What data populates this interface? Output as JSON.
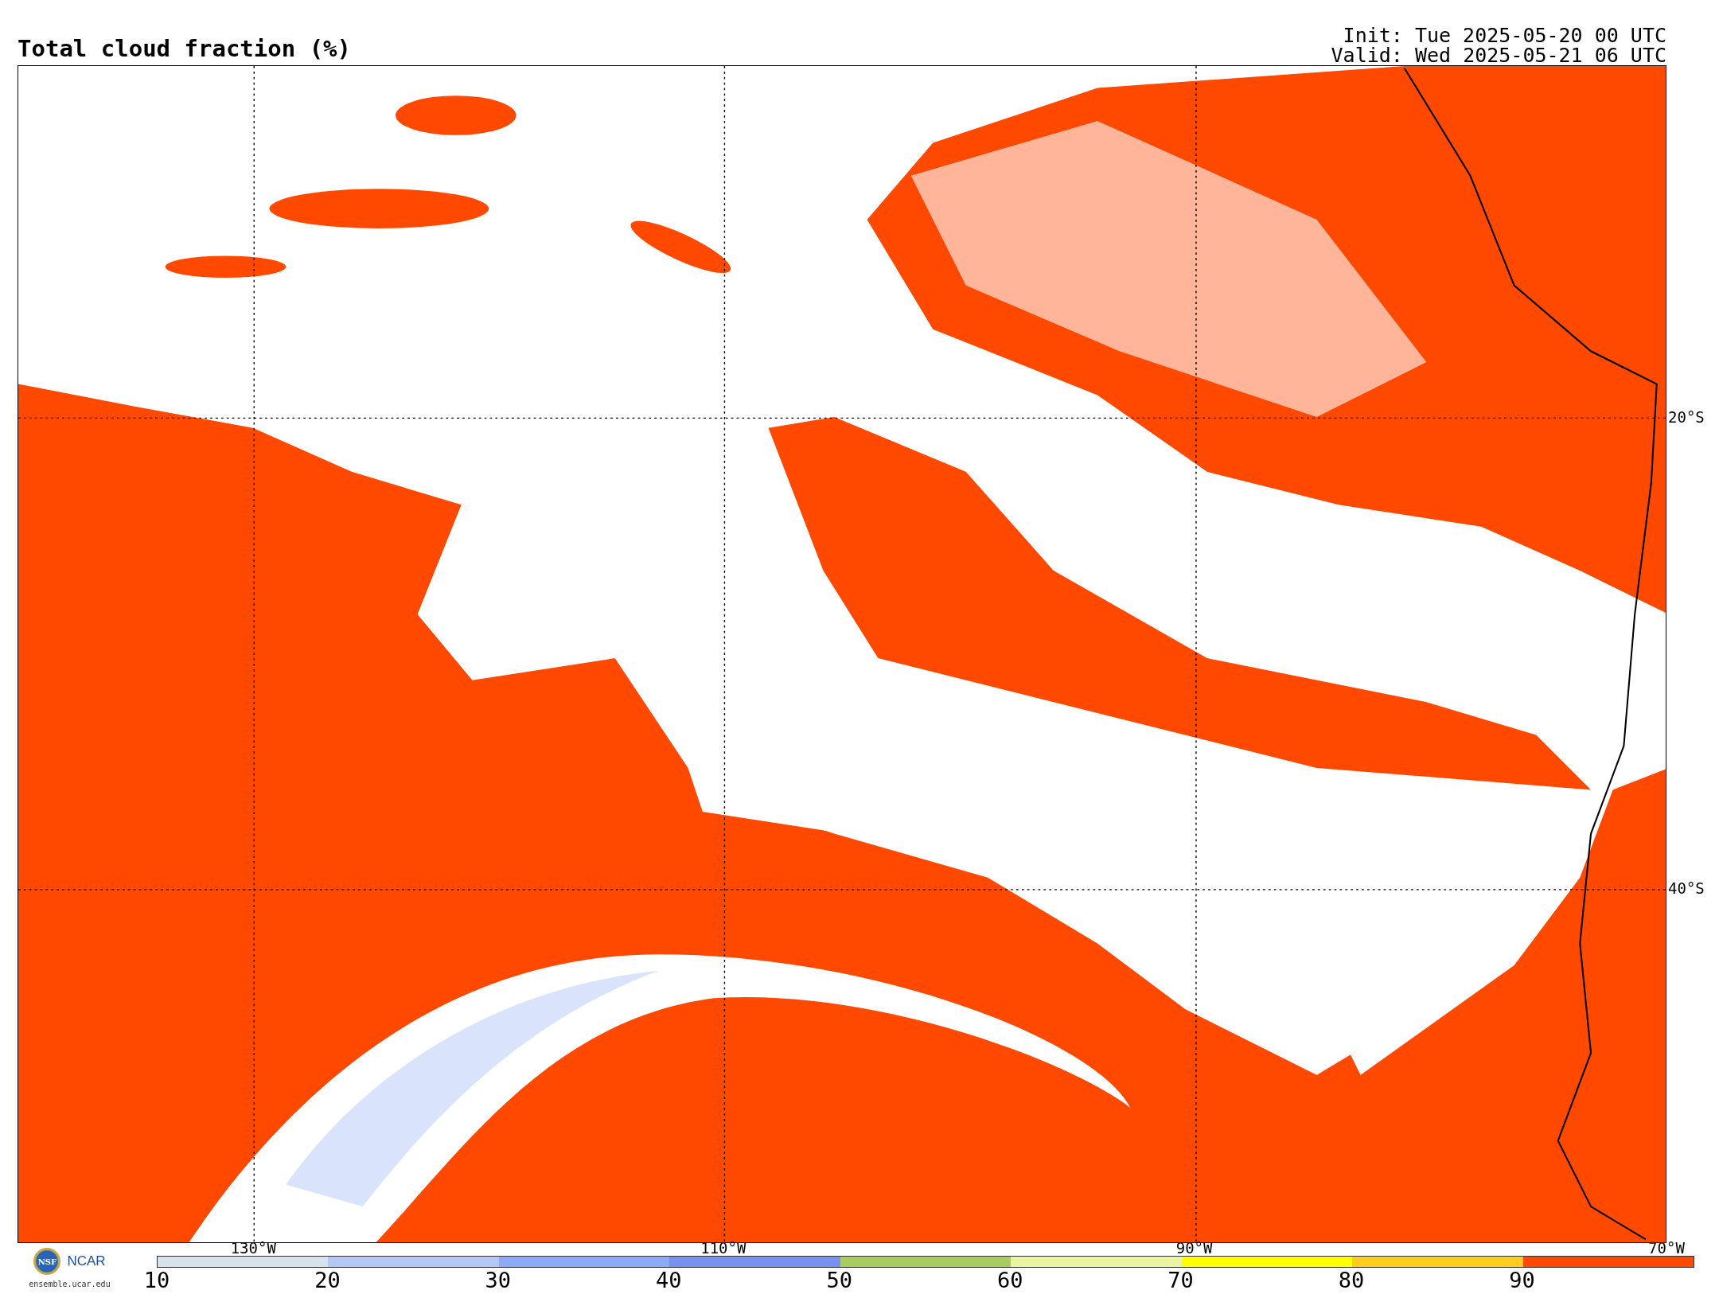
{
  "title": "Total cloud fraction (%)",
  "init": "Init: Tue 2025-05-20 00 UTC",
  "valid": "Valid: Wed 2025-05-21 06 UTC",
  "lat_labels": [
    "20°S",
    "40°S"
  ],
  "lon_labels": [
    "130°W",
    "110°W",
    "90°W",
    "70°W"
  ],
  "colorbar": [
    {
      "label": "10",
      "color": "#d6e2ec"
    },
    {
      "label": "20",
      "color": "#b4c8f8"
    },
    {
      "label": "30",
      "color": "#8caaf8"
    },
    {
      "label": "40",
      "color": "#7890f0"
    },
    {
      "label": "50",
      "color": "#a8cc60"
    },
    {
      "label": "60",
      "color": "#e8f4a0"
    },
    {
      "label": "70",
      "color": "#ffff00"
    },
    {
      "label": "80",
      "color": "#ffcc20"
    },
    {
      "label": "90",
      "color": "#ff4800"
    }
  ],
  "logo": {
    "nsf": "NSF",
    "ncar": "NCAR",
    "url": "ensemble.ucar.edu"
  }
}
